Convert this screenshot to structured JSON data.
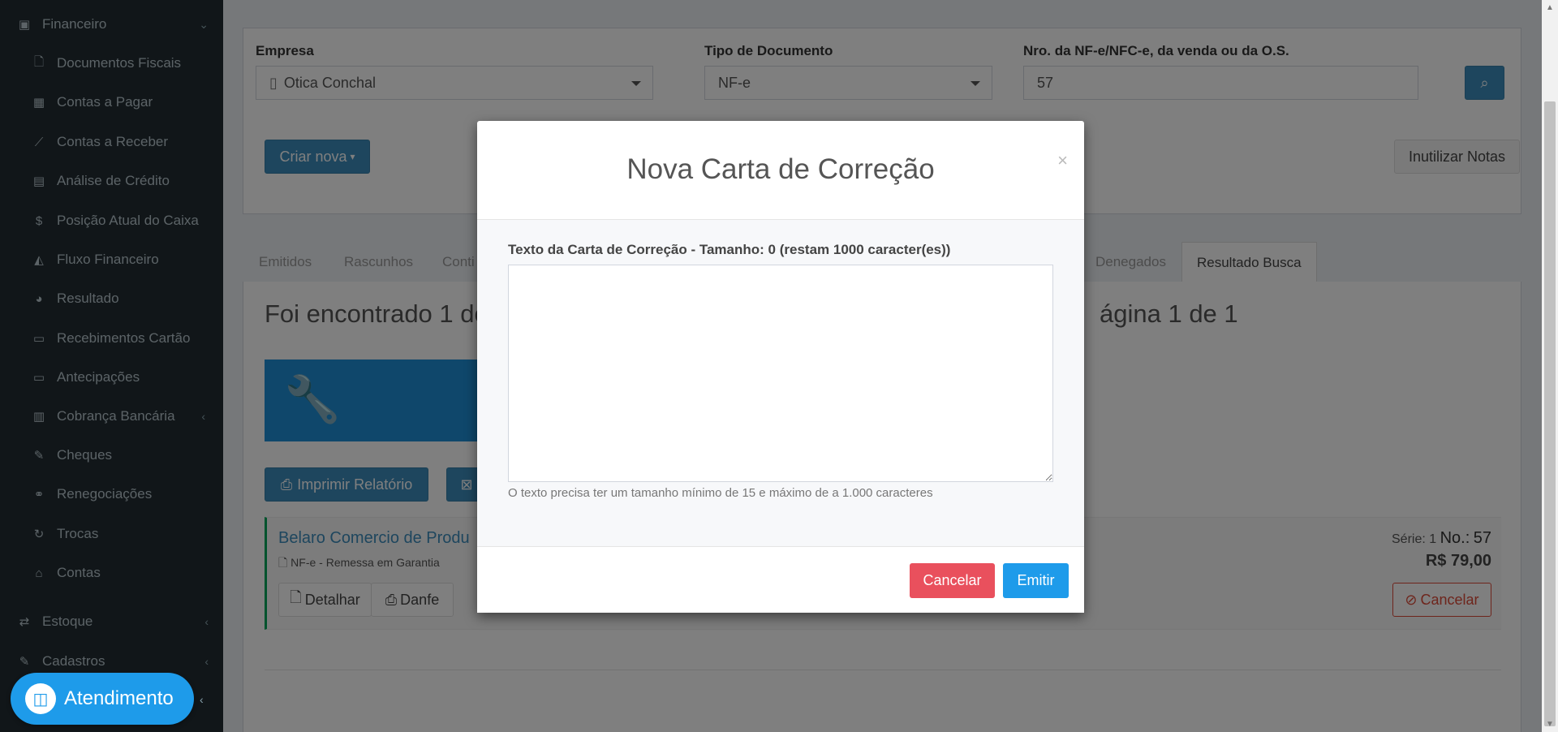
{
  "sidebar": {
    "groups": [
      {
        "label": "Financeiro",
        "icon": "money-icon",
        "chevron": "⌄"
      },
      {
        "label": "Estoque",
        "icon": "exchange-icon",
        "chevron": "‹"
      },
      {
        "label": "Cadastros",
        "icon": "edit-icon",
        "chevron": "‹"
      }
    ],
    "items": [
      {
        "label": "Documentos Fiscais",
        "icon": "file-icon"
      },
      {
        "label": "Contas a Pagar",
        "icon": "calculator-icon"
      },
      {
        "label": "Contas a Receber",
        "icon": "line-chart-icon"
      },
      {
        "label": "Análise de Crédito",
        "icon": "id-card-icon"
      },
      {
        "label": "Posição Atual do Caixa",
        "icon": "dollar-icon"
      },
      {
        "label": "Fluxo Financeiro",
        "icon": "area-chart-icon"
      },
      {
        "label": "Resultado",
        "icon": "pie-chart-icon"
      },
      {
        "label": "Recebimentos Cartão",
        "icon": "credit-card-icon"
      },
      {
        "label": "Antecipações",
        "icon": "card-icon"
      },
      {
        "label": "Cobrança Bancária",
        "icon": "barcode-icon"
      },
      {
        "label": "Cheques",
        "icon": "edit-icon"
      },
      {
        "label": "Renegociações",
        "icon": "handshake-icon"
      },
      {
        "label": "Trocas",
        "icon": "refresh-icon"
      },
      {
        "label": "Contas",
        "icon": "bank-icon"
      }
    ],
    "atendimento": "Atendimento"
  },
  "filters": {
    "empresa_label": "Empresa",
    "empresa_value": "Otica Conchal",
    "tipo_label": "Tipo de Documento",
    "tipo_value": "NF-e",
    "nro_label": "Nro. da NF-e/NFC-e, da venda ou da O.S.",
    "nro_value": "57",
    "criar_nova": "Criar nova",
    "inutilizar": "Inutilizar Notas"
  },
  "tabs": [
    "Emitidos",
    "Rascunhos",
    "Conti",
    "Denegados",
    "Resultado Busca"
  ],
  "results": {
    "summary_left": "Foi encontrado 1 do",
    "summary_right": "ágina 1 de 1",
    "imprimir": "Imprimir Relatório",
    "company": "Belaro Comercio de Produ",
    "doc_type": "NF-e - Remessa em Garantia",
    "serie_label": "Série:",
    "serie_value": "1",
    "no_label": "No.:",
    "no_value": "57",
    "total": "R$ 79,00",
    "cancelar": "Cancelar",
    "detalhar": "Detalhar",
    "danfe": "Danfe"
  },
  "modal": {
    "title": "Nova Carta de Correção",
    "close": "×",
    "label": "Texto da Carta de Correção - Tamanho: 0 (restam 1000 caracter(es))",
    "textarea_value": "",
    "help": "O texto precisa ter um tamanho mínimo de 15 e máximo de a 1.000 caracteres",
    "cancel": "Cancelar",
    "emit": "Emitir"
  }
}
